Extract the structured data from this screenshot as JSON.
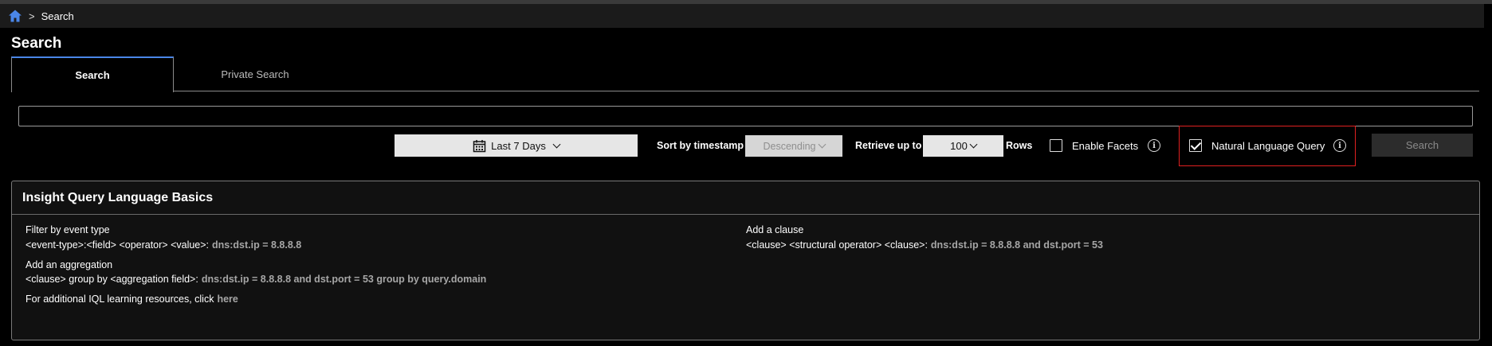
{
  "breadcrumb": {
    "separator": ">",
    "current": "Search"
  },
  "page": {
    "title": "Search"
  },
  "tabs": [
    {
      "label": "Search",
      "active": true
    },
    {
      "label": "Private Search",
      "active": false
    }
  ],
  "query": {
    "value": "",
    "placeholder": ""
  },
  "controls": {
    "date_range": "Last 7 Days",
    "sort_label": "Sort by timestamp",
    "sort_value": "Descending",
    "retrieve_label": "Retrieve up to",
    "rows_value": "100",
    "rows_label": "Rows",
    "facets_label": "Enable Facets",
    "facets_checked": false,
    "nlq_label": "Natural Language Query",
    "nlq_checked": true,
    "search_button": "Search",
    "info_glyph": "i"
  },
  "basics": {
    "title": "Insight Query Language Basics",
    "filter_heading": "Filter by event type",
    "filter_syntax": "<event-type>:<field> <operator> <value>:",
    "filter_example": "dns:dst.ip = 8.8.8.8",
    "clause_heading": "Add a clause",
    "clause_syntax": "<clause> <structural operator> <clause>:",
    "clause_example": "dns:dst.ip = 8.8.8.8 and dst.port = 53",
    "agg_heading": "Add an aggregation",
    "agg_syntax": "<clause> group by <aggregation field>:",
    "agg_example": "dns:dst.ip = 8.8.8.8 and dst.port = 53 group by query.domain",
    "resources_text": "For additional IQL learning resources, click",
    "resources_link": "here"
  },
  "colors": {
    "accent_tab": "#4a86e8",
    "highlight_border": "#e02020",
    "home_icon": "#4a86e8"
  },
  "icons": {
    "home": "home-icon",
    "calendar": "calendar-icon",
    "info": "info-icon",
    "chevron": "chevron-down-icon"
  }
}
